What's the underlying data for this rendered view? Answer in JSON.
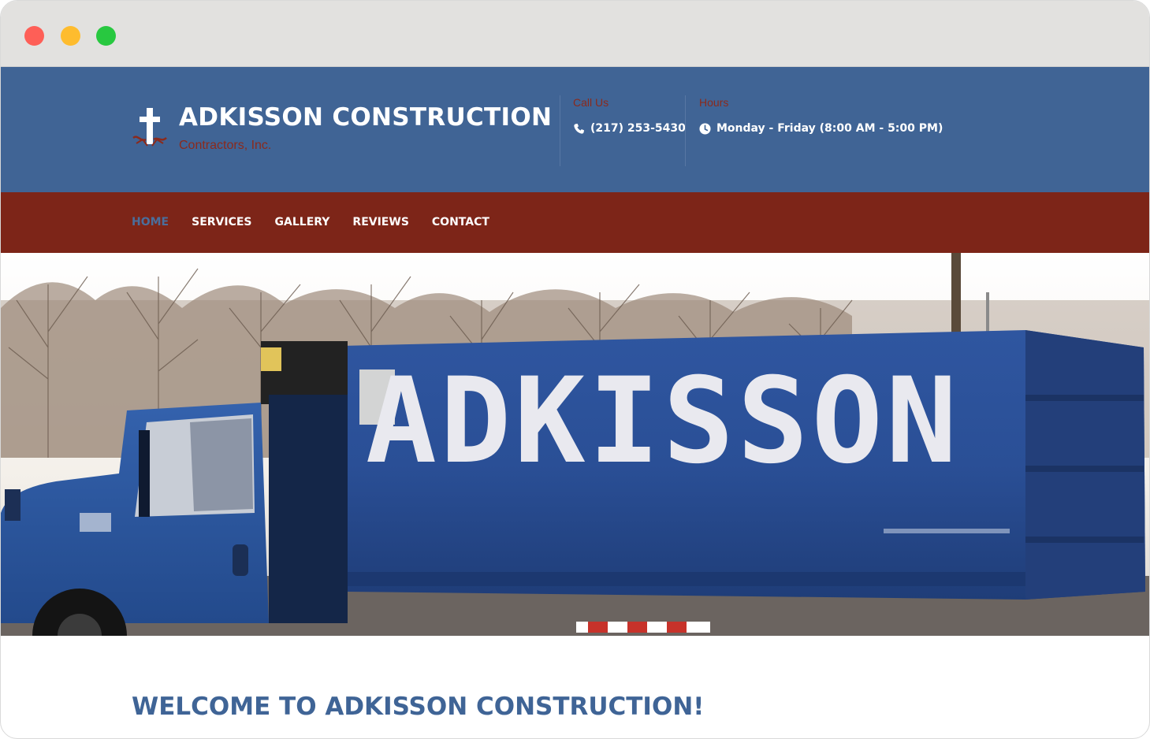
{
  "window": {
    "controls": [
      "close",
      "minimize",
      "maximize"
    ],
    "colors": {
      "close": "#fe5f57",
      "minimize": "#febc2e",
      "maximize": "#28c840"
    }
  },
  "header": {
    "brand_title": "ADKISSON CONSTRUCTION",
    "brand_subtitle": "Contractors, Inc.",
    "logo_icon": "cross-logo-icon",
    "call_label": "Call Us",
    "phone": "(217) 253-5430",
    "phone_icon": "phone-icon",
    "hours_label": "Hours",
    "hours": "Monday - Friday (8:00 AM - 5:00 PM)",
    "hours_icon": "clock-icon",
    "colors": {
      "background": "#406495",
      "label": "#8b2a1c"
    }
  },
  "nav": {
    "items": [
      {
        "label": "HOME",
        "active": true
      },
      {
        "label": "SERVICES",
        "active": false
      },
      {
        "label": "GALLERY",
        "active": false
      },
      {
        "label": "REVIEWS",
        "active": false
      },
      {
        "label": "CONTACT",
        "active": false
      }
    ],
    "colors": {
      "background": "#7d2518",
      "active": "#4a6e9c"
    }
  },
  "hero": {
    "truck_text": "ADKISSON"
  },
  "main": {
    "welcome_heading": "WELCOME TO ADKISSON CONSTRUCTION!"
  }
}
